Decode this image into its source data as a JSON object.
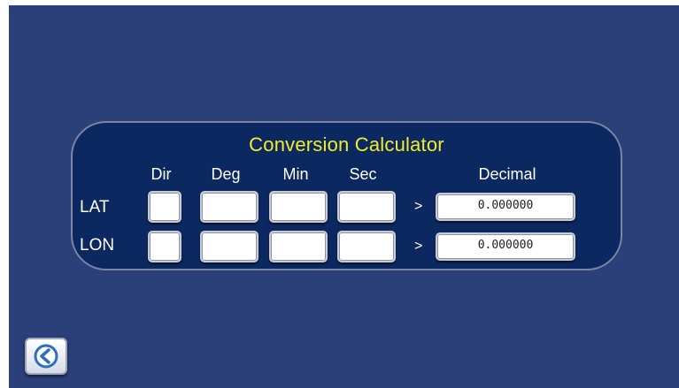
{
  "calculator": {
    "title": "Conversion Calculator",
    "headers": {
      "dir": "Dir",
      "deg": "Deg",
      "min": "Min",
      "sec": "Sec",
      "decimal": "Decimal"
    },
    "rows": [
      {
        "label": "LAT",
        "arrow": ">",
        "dir": "",
        "deg": "",
        "min": "",
        "sec": "",
        "decimal": "0.000000"
      },
      {
        "label": "LON",
        "arrow": ">",
        "dir": "",
        "deg": "",
        "min": "",
        "sec": "",
        "decimal": "0.000000"
      }
    ]
  },
  "back_button": {
    "icon": "back-arrow-icon"
  },
  "colors": {
    "background": "#2b3f78",
    "panel": "#0c2860",
    "title": "#f3ec2a",
    "text": "#ffffff"
  }
}
